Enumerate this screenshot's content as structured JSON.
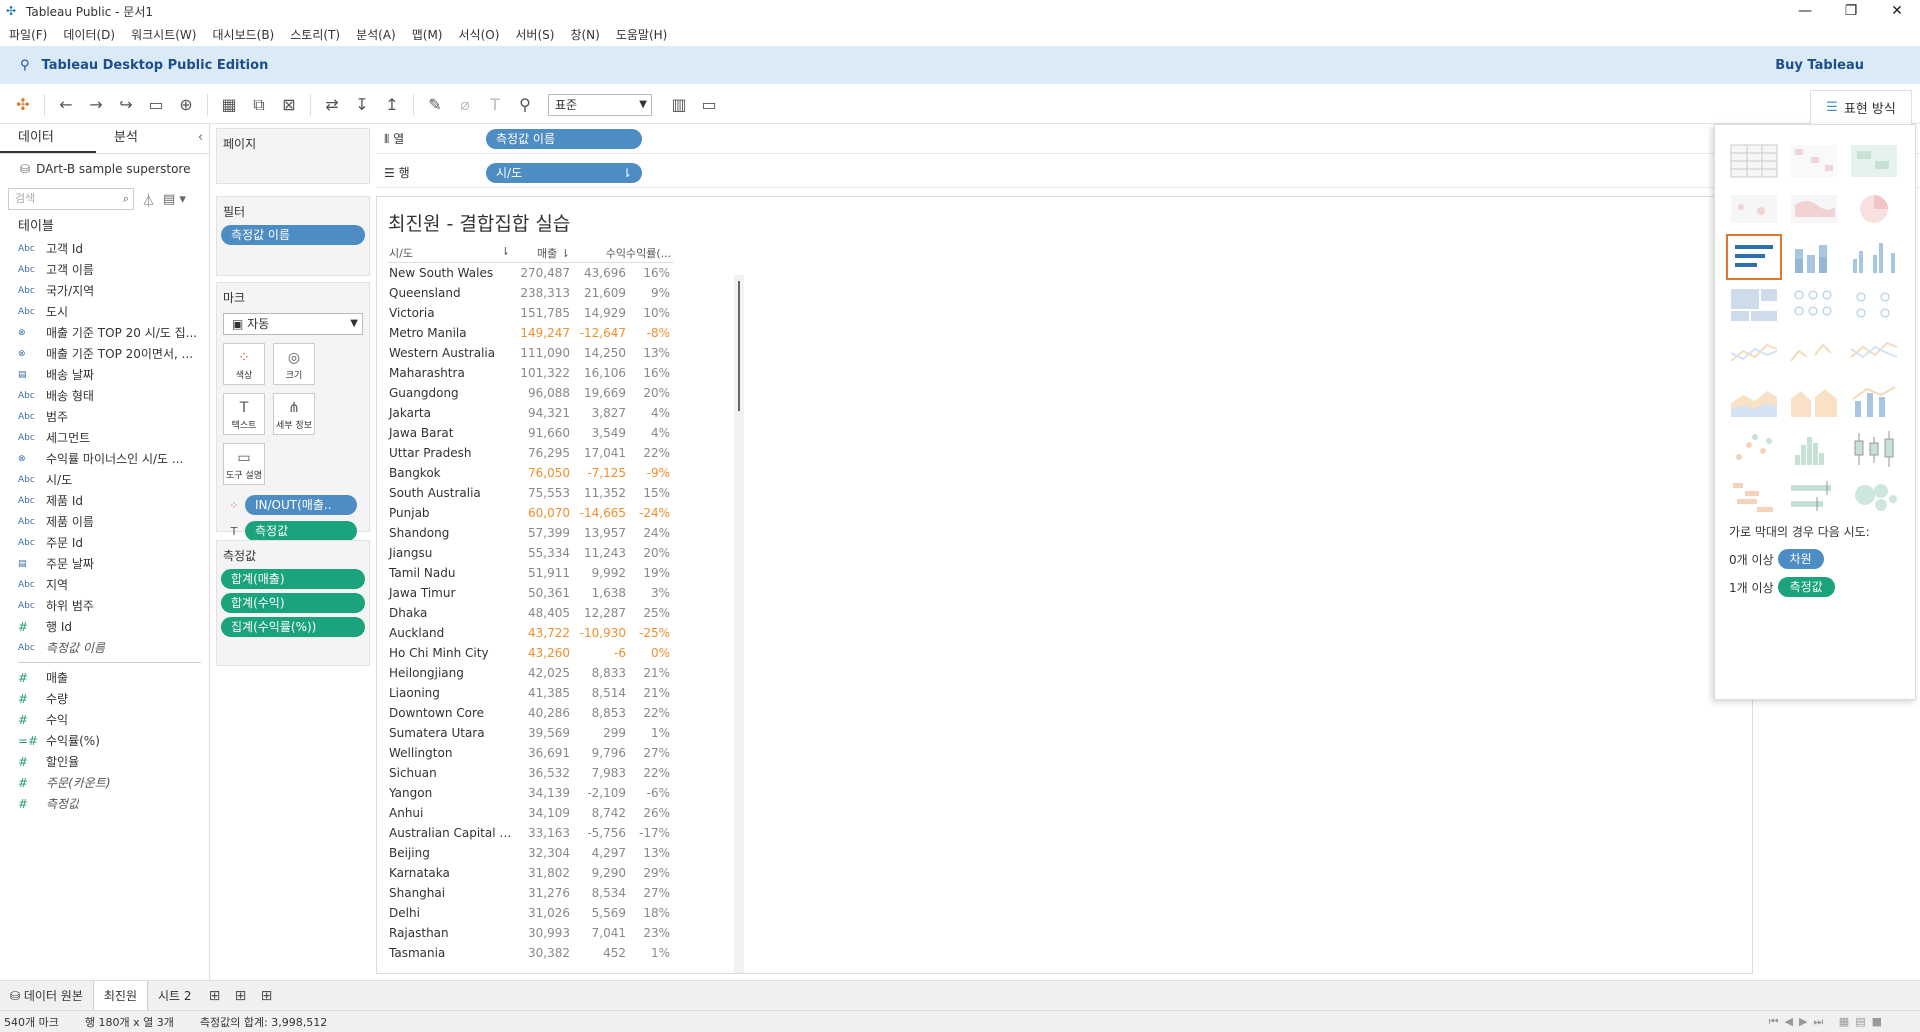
{
  "window": {
    "title": "Tableau Public - 문서1"
  },
  "menu": [
    "파일(F)",
    "데이터(D)",
    "워크시트(W)",
    "대시보드(B)",
    "스토리(T)",
    "분석(A)",
    "맵(M)",
    "서식(O)",
    "서버(S)",
    "창(N)",
    "도움말(H)"
  ],
  "banner": {
    "edition": "Tableau Desktop Public Edition",
    "buy": "Buy Tableau"
  },
  "toolbar": {
    "fit_value": "표준",
    "show_me_label": "표현 방식"
  },
  "datapane": {
    "tab_data": "데이터",
    "tab_analysis": "분석",
    "datasource": "DArt-B sample superstore",
    "search_placeholder": "검색",
    "tables_header": "테이블",
    "dimensions": [
      {
        "type": "Abc",
        "name": "고객 Id"
      },
      {
        "type": "Abc",
        "name": "고객 이름"
      },
      {
        "type": "Abc",
        "name": "국가/지역"
      },
      {
        "type": "Abc",
        "name": "도시"
      },
      {
        "type": "set",
        "name": "매출 기준 TOP 20 시/도 집..."
      },
      {
        "type": "set",
        "name": "매출 기준 TOP 20이면서, ..."
      },
      {
        "type": "date",
        "name": "배송 날짜"
      },
      {
        "type": "Abc",
        "name": "배송 형태"
      },
      {
        "type": "Abc",
        "name": "범주"
      },
      {
        "type": "Abc",
        "name": "세그먼트"
      },
      {
        "type": "set",
        "name": "수익률 마이너스인 시/도 ..."
      },
      {
        "type": "Abc",
        "name": "시/도"
      },
      {
        "type": "Abc",
        "name": "제품 Id"
      },
      {
        "type": "Abc",
        "name": "제품 이름"
      },
      {
        "type": "Abc",
        "name": "주문 Id"
      },
      {
        "type": "date",
        "name": "주문 날짜"
      },
      {
        "type": "Abc",
        "name": "지역"
      },
      {
        "type": "Abc",
        "name": "하위 범주"
      },
      {
        "type": "#",
        "name": "행 Id"
      },
      {
        "type": "Abc",
        "name": "측정값 이름",
        "italic": true
      }
    ],
    "measures": [
      {
        "type": "#",
        "name": "매출"
      },
      {
        "type": "#",
        "name": "수량"
      },
      {
        "type": "#",
        "name": "수익"
      },
      {
        "type": "=#",
        "name": "수익률(%)"
      },
      {
        "type": "#",
        "name": "할인율"
      },
      {
        "type": "#",
        "name": "주문(카운트)",
        "italic": true
      },
      {
        "type": "#",
        "name": "측정값",
        "italic": true
      }
    ]
  },
  "cards": {
    "pages": "페이지",
    "filters": "필터",
    "filter_pill": "측정값 이름",
    "marks": "마크",
    "mark_type": "자동",
    "mark_buttons": [
      "색상",
      "크기",
      "텍스트",
      "세부 정보",
      "도구 설명"
    ],
    "mark_pills": [
      "IN/OUT(매출..",
      "측정값"
    ],
    "measure_values": "측정값",
    "measure_pills": [
      "합계(매출)",
      "합계(수익)",
      "집계(수익률(%))"
    ]
  },
  "shelves": {
    "columns_label": "열",
    "columns_pill": "측정값 이름",
    "rows_label": "행",
    "rows_pill": "시/도"
  },
  "view": {
    "title": "최진원 - 결합집합 실습",
    "headers": [
      "시/도",
      "매출",
      "수익",
      "수익률(..."
    ],
    "rows": [
      [
        "New South Wales",
        "270,487",
        "43,696",
        "16%",
        false
      ],
      [
        "Queensland",
        "238,313",
        "21,609",
        "9%",
        false
      ],
      [
        "Victoria",
        "151,785",
        "14,929",
        "10%",
        false
      ],
      [
        "Metro Manila",
        "149,247",
        "-12,647",
        "-8%",
        true
      ],
      [
        "Western Australia",
        "111,090",
        "14,250",
        "13%",
        false
      ],
      [
        "Maharashtra",
        "101,322",
        "16,106",
        "16%",
        false
      ],
      [
        "Guangdong",
        "96,088",
        "19,669",
        "20%",
        false
      ],
      [
        "Jakarta",
        "94,321",
        "3,827",
        "4%",
        false
      ],
      [
        "Jawa Barat",
        "91,660",
        "3,549",
        "4%",
        false
      ],
      [
        "Uttar Pradesh",
        "76,295",
        "17,041",
        "22%",
        false
      ],
      [
        "Bangkok",
        "76,050",
        "-7,125",
        "-9%",
        true
      ],
      [
        "South Australia",
        "75,553",
        "11,352",
        "15%",
        false
      ],
      [
        "Punjab",
        "60,070",
        "-14,665",
        "-24%",
        true
      ],
      [
        "Shandong",
        "57,399",
        "13,957",
        "24%",
        false
      ],
      [
        "Jiangsu",
        "55,334",
        "11,243",
        "20%",
        false
      ],
      [
        "Tamil Nadu",
        "51,911",
        "9,992",
        "19%",
        false
      ],
      [
        "Jawa Timur",
        "50,361",
        "1,638",
        "3%",
        false
      ],
      [
        "Dhaka",
        "48,405",
        "12,287",
        "25%",
        false
      ],
      [
        "Auckland",
        "43,722",
        "-10,930",
        "-25%",
        true
      ],
      [
        "Ho Chi Minh City",
        "43,260",
        "-6",
        "0%",
        true
      ],
      [
        "Heilongjiang",
        "42,025",
        "8,833",
        "21%",
        false
      ],
      [
        "Liaoning",
        "41,385",
        "8,514",
        "21%",
        false
      ],
      [
        "Downtown Core",
        "40,286",
        "8,853",
        "22%",
        false
      ],
      [
        "Sumatera Utara",
        "39,569",
        "299",
        "1%",
        false
      ],
      [
        "Wellington",
        "36,691",
        "9,796",
        "27%",
        false
      ],
      [
        "Sichuan",
        "36,532",
        "7,983",
        "22%",
        false
      ],
      [
        "Yangon",
        "34,139",
        "-2,109",
        "-6%",
        false
      ],
      [
        "Anhui",
        "34,109",
        "8,742",
        "26%",
        false
      ],
      [
        "Australian Capital Territo..",
        "33,163",
        "-5,756",
        "-17%",
        false
      ],
      [
        "Beijing",
        "32,304",
        "4,297",
        "13%",
        false
      ],
      [
        "Karnataka",
        "31,802",
        "9,290",
        "29%",
        false
      ],
      [
        "Shanghai",
        "31,276",
        "8,534",
        "27%",
        false
      ],
      [
        "Delhi",
        "31,026",
        "5,569",
        "18%",
        false
      ],
      [
        "Rajasthan",
        "30,993",
        "7,041",
        "23%",
        false
      ],
      [
        "Tasmania",
        "30,382",
        "452",
        "1%",
        false
      ]
    ]
  },
  "showme": {
    "hint": "가로 막대의 경우 다음 시도:",
    "req1_prefix": "0개 이상",
    "req1_pill": "차원",
    "req2_prefix": "1개 이상",
    "req2_pill": "측정값"
  },
  "tabs": {
    "datasource": "데이터 원본",
    "sheet1": "최진원",
    "sheet2": "시트 2"
  },
  "status": {
    "marks": "540개 마크",
    "rows_cols": "행 180개 x 열 3개",
    "sum": "측정값의 합계: 3,998,512"
  },
  "colors": {
    "accent": "#1aa37c",
    "negative": "#f28e2b",
    "banner": "#dbeaf7"
  }
}
